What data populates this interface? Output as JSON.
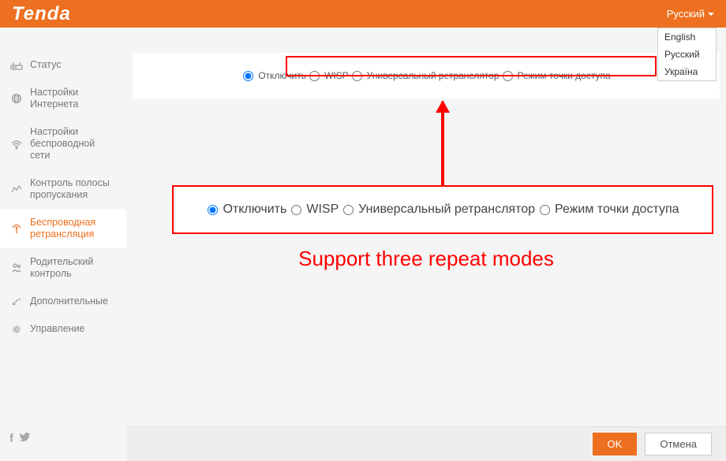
{
  "header": {
    "logo": "Tenda",
    "lang_current": "Русский",
    "lang_options": [
      "English",
      "Русский",
      "Україна"
    ]
  },
  "sidebar": {
    "items": [
      {
        "label": "Статус"
      },
      {
        "label": "Настройки Интернета"
      },
      {
        "label": "Настройки беспроводной сети"
      },
      {
        "label": "Контроль полосы пропускания"
      },
      {
        "label": "Беспроводная ретрансляция"
      },
      {
        "label": "Родительский контроль"
      },
      {
        "label": "Дополнительные"
      },
      {
        "label": "Управление"
      }
    ]
  },
  "modes": {
    "opt_disable": "Отключить",
    "opt_wisp": "WISP",
    "opt_universal": "Универсальный ретранслятор",
    "opt_ap": "Режим точки доступа"
  },
  "annotation": "Support three repeat modes",
  "footer": {
    "ok": "OK",
    "cancel": "Отмена"
  }
}
